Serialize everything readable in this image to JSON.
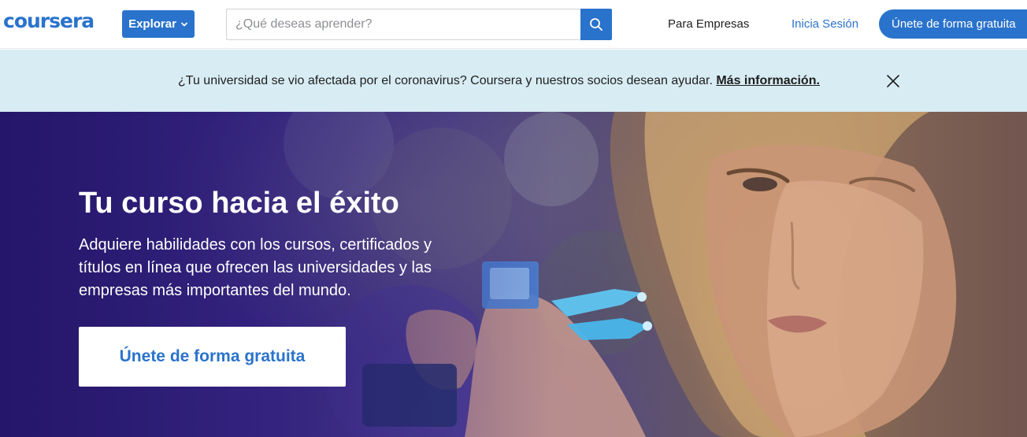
{
  "header": {
    "logo_text": "coursera",
    "explore_label": "Explorar",
    "search_placeholder": "¿Qué deseas aprender?",
    "search_value": "",
    "nav_business": "Para Empresas",
    "nav_login": "Inicia Sesión",
    "join_label": "Únete de forma gratuita"
  },
  "banner": {
    "message": "¿Tu universidad se vio afectada por el coronavirus? Coursera y nuestros socios desean ayudar.",
    "link_label": "Más información."
  },
  "hero": {
    "title": "Tu curso hacia el éxito",
    "subtitle": "Adquiere habilidades con los cursos, certificados y títulos en línea que ofrecen las universidades y las empresas más importantes del mundo.",
    "cta_label": "Únete de forma gratuita"
  },
  "icons": {
    "search": "search-icon",
    "chevron": "chevron-down-icon",
    "close": "close-icon"
  },
  "colors": {
    "brand": "#2a73cc",
    "banner_bg": "#d8ecf3",
    "hero_dark": "#2a1b6e"
  }
}
